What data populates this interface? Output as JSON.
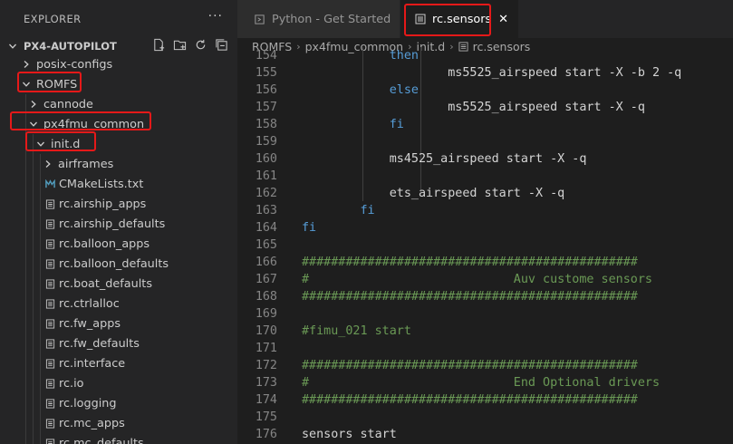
{
  "sidebar": {
    "title": "EXPLORER",
    "more": "···",
    "root": "PX4-AUTOPILOT",
    "items": [
      {
        "label": "posix-configs",
        "kind": "folder",
        "expanded": false,
        "level": 1
      },
      {
        "label": "ROMFS",
        "kind": "folder",
        "expanded": true,
        "level": 1
      },
      {
        "label": "cannode",
        "kind": "folder",
        "expanded": false,
        "level": 2
      },
      {
        "label": "px4fmu_common",
        "kind": "folder",
        "expanded": true,
        "level": 2
      },
      {
        "label": "init.d",
        "kind": "folder",
        "expanded": true,
        "level": 3
      },
      {
        "label": "airframes",
        "kind": "folder",
        "expanded": false,
        "level": 4
      },
      {
        "label": "CMakeLists.txt",
        "kind": "cmake",
        "level": 4
      },
      {
        "label": "rc.airship_apps",
        "kind": "file",
        "level": 4
      },
      {
        "label": "rc.airship_defaults",
        "kind": "file",
        "level": 4
      },
      {
        "label": "rc.balloon_apps",
        "kind": "file",
        "level": 4
      },
      {
        "label": "rc.balloon_defaults",
        "kind": "file",
        "level": 4
      },
      {
        "label": "rc.boat_defaults",
        "kind": "file",
        "level": 4
      },
      {
        "label": "rc.ctrlalloc",
        "kind": "file",
        "level": 4
      },
      {
        "label": "rc.fw_apps",
        "kind": "file",
        "level": 4
      },
      {
        "label": "rc.fw_defaults",
        "kind": "file",
        "level": 4
      },
      {
        "label": "rc.interface",
        "kind": "file",
        "level": 4
      },
      {
        "label": "rc.io",
        "kind": "file",
        "level": 4
      },
      {
        "label": "rc.logging",
        "kind": "file",
        "level": 4
      },
      {
        "label": "rc.mc_apps",
        "kind": "file",
        "level": 4
      },
      {
        "label": "rc.mc_defaults",
        "kind": "file",
        "level": 4
      }
    ]
  },
  "tabs": [
    {
      "label": "Python - Get Started",
      "active": false
    },
    {
      "label": "rc.sensors",
      "active": true
    }
  ],
  "breadcrumb": [
    "ROMFS",
    "px4fmu_common",
    "init.d",
    "rc.sensors"
  ],
  "code": [
    {
      "n": "154",
      "t": "            then",
      "c": "kw"
    },
    {
      "n": "155",
      "t": "                    ms5525_airspeed start -X -b 2 -q",
      "c": "tx"
    },
    {
      "n": "156",
      "t": "            else",
      "c": "kw"
    },
    {
      "n": "157",
      "t": "                    ms5525_airspeed start -X -q",
      "c": "tx"
    },
    {
      "n": "158",
      "t": "            fi",
      "c": "kw"
    },
    {
      "n": "159",
      "t": "",
      "c": "tx"
    },
    {
      "n": "160",
      "t": "            ms4525_airspeed start -X -q",
      "c": "tx"
    },
    {
      "n": "161",
      "t": "",
      "c": "tx"
    },
    {
      "n": "162",
      "t": "            ets_airspeed start -X -q",
      "c": "tx"
    },
    {
      "n": "163",
      "t": "        fi",
      "c": "kw"
    },
    {
      "n": "164",
      "t": "fi",
      "c": "kw"
    },
    {
      "n": "165",
      "t": "",
      "c": "tx"
    },
    {
      "n": "166",
      "t": "##############################################",
      "c": "cm"
    },
    {
      "n": "167",
      "t": "#                            Auv custome sensors",
      "c": "cm"
    },
    {
      "n": "168",
      "t": "##############################################",
      "c": "cm"
    },
    {
      "n": "169",
      "t": "",
      "c": "tx"
    },
    {
      "n": "170",
      "t": "#fimu_021 start",
      "c": "cm"
    },
    {
      "n": "171",
      "t": "",
      "c": "tx"
    },
    {
      "n": "172",
      "t": "##############################################",
      "c": "cm"
    },
    {
      "n": "173",
      "t": "#                            End Optional drivers",
      "c": "cm"
    },
    {
      "n": "174",
      "t": "##############################################",
      "c": "cm"
    },
    {
      "n": "175",
      "t": "",
      "c": "tx"
    },
    {
      "n": "176",
      "t": "sensors start",
      "c": "tx"
    }
  ],
  "colors": {
    "highlight": "#e51919",
    "keyword": "#569cd6",
    "comment": "#6a9955",
    "text": "#d4d4d4"
  }
}
